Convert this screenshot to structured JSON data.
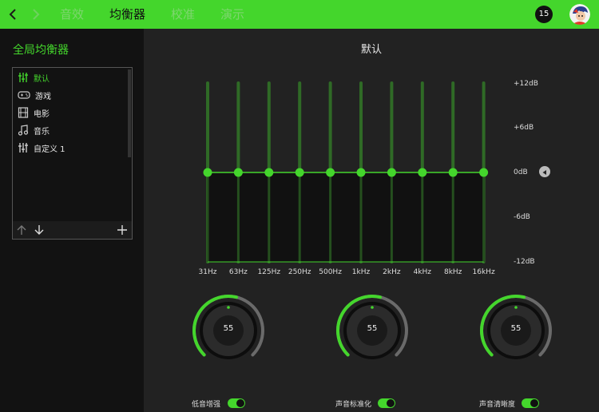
{
  "header": {
    "back_icon": "chevron-left-icon",
    "forward_icon": "chevron-right-icon",
    "tabs": [
      {
        "label": "音效",
        "active": false
      },
      {
        "label": "均衡器",
        "active": true
      },
      {
        "label": "校准",
        "active": false
      },
      {
        "label": "演示",
        "active": false
      }
    ],
    "notification_count": "15",
    "accent_color": "#44d62c"
  },
  "sidebar": {
    "title": "全局均衡器",
    "presets": [
      {
        "label": "默认",
        "icon": "sliders-icon",
        "active": true
      },
      {
        "label": "游戏",
        "icon": "gamepad-icon",
        "active": false
      },
      {
        "label": "电影",
        "icon": "film-icon",
        "active": false
      },
      {
        "label": "音乐",
        "icon": "music-note-icon",
        "active": false
      },
      {
        "label": "自定义 1",
        "icon": "sliders-icon",
        "active": false
      }
    ],
    "footer_icons": [
      "arrow-up-icon",
      "arrow-down-icon",
      "plus-icon"
    ]
  },
  "equalizer": {
    "preset_name": "默认",
    "db_labels": [
      "+12dB",
      "+6dB",
      "0dB",
      "-6dB",
      "-12dB"
    ],
    "bands": [
      {
        "label": "31Hz",
        "value_db": 0
      },
      {
        "label": "63Hz",
        "value_db": 0
      },
      {
        "label": "125Hz",
        "value_db": 0
      },
      {
        "label": "250Hz",
        "value_db": 0
      },
      {
        "label": "500Hz",
        "value_db": 0
      },
      {
        "label": "1kHz",
        "value_db": 0
      },
      {
        "label": "2kHz",
        "value_db": 0
      },
      {
        "label": "4kHz",
        "value_db": 0
      },
      {
        "label": "8kHz",
        "value_db": 0
      },
      {
        "label": "16kHz",
        "value_db": 0
      }
    ],
    "range_db": [
      -12,
      12
    ]
  },
  "knobs": [
    {
      "label": "低音增强",
      "value": "55",
      "enabled": true
    },
    {
      "label": "声音标准化",
      "value": "55",
      "enabled": true
    },
    {
      "label": "声音清晰度",
      "value": "55",
      "enabled": true
    }
  ]
}
